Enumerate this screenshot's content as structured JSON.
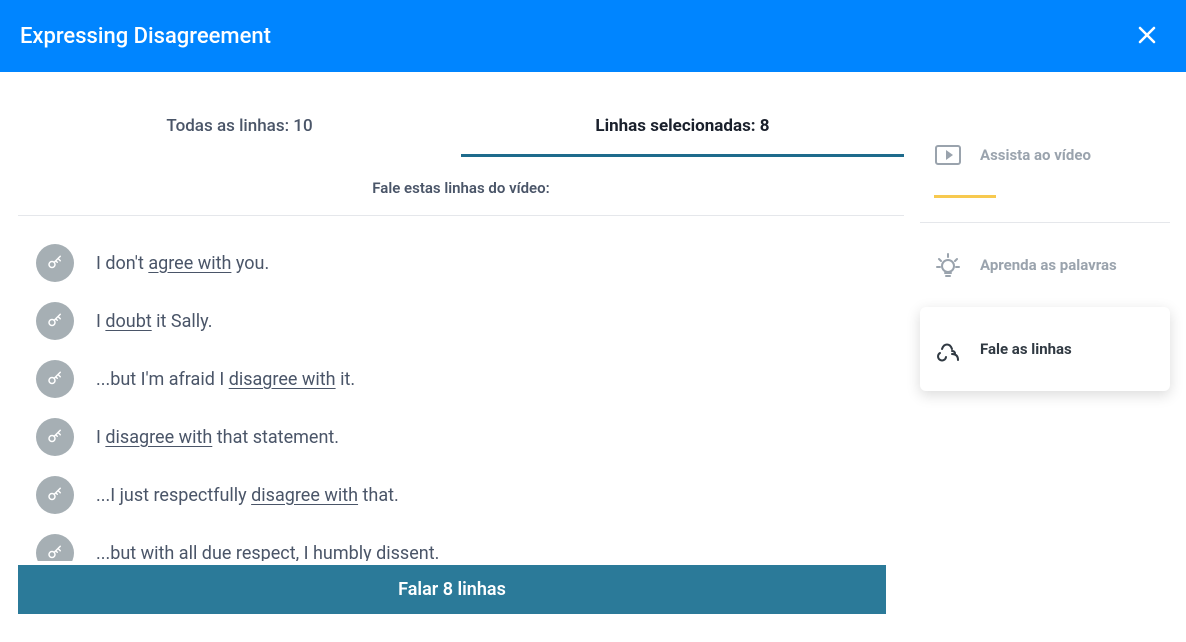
{
  "header": {
    "title": "Expressing Disagreement"
  },
  "tabs": {
    "all_lines_label": "Todas as linhas: 10",
    "selected_lines_label": "Linhas selecionadas: 8"
  },
  "subtitle": "Fale estas linhas do vídeo:",
  "lines": [
    {
      "parts": [
        {
          "t": "I don't "
        },
        {
          "t": "agree with",
          "u": true
        },
        {
          "t": " you."
        }
      ]
    },
    {
      "parts": [
        {
          "t": "I "
        },
        {
          "t": "doubt",
          "u": true
        },
        {
          "t": " it Sally."
        }
      ]
    },
    {
      "parts": [
        {
          "t": "...but I'm afraid I "
        },
        {
          "t": "disagree with",
          "u": true
        },
        {
          "t": " it."
        }
      ]
    },
    {
      "parts": [
        {
          "t": "I "
        },
        {
          "t": "disagree with",
          "u": true
        },
        {
          "t": " that statement."
        }
      ]
    },
    {
      "parts": [
        {
          "t": "...I just respectfully "
        },
        {
          "t": "disagree with",
          "u": true
        },
        {
          "t": " that."
        }
      ]
    },
    {
      "parts": [
        {
          "t": "...but "
        },
        {
          "t": "with all due respect",
          "u": true
        },
        {
          "t": ", I humbly "
        },
        {
          "t": "dissent",
          "u": true
        },
        {
          "t": "."
        }
      ]
    }
  ],
  "speak_button": "Falar 8 linhas",
  "sidebar": {
    "watch": "Assista ao vídeo",
    "learn": "Aprenda as palavras",
    "speak": "Fale as linhas"
  }
}
